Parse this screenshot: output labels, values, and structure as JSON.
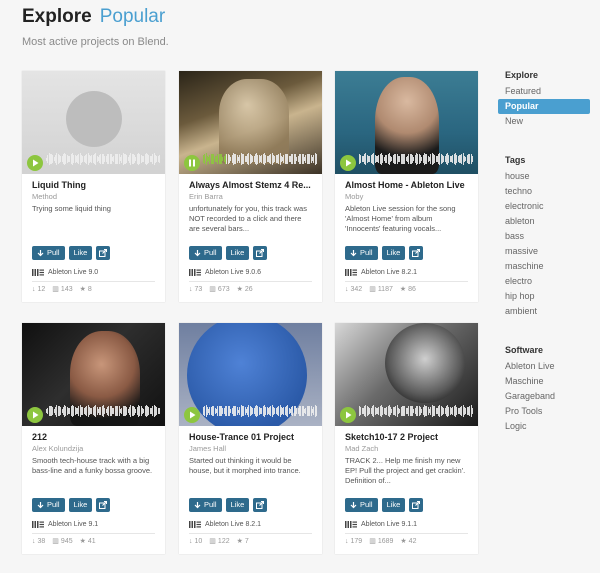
{
  "header": {
    "title": "Explore",
    "subtitle_tab": "Popular",
    "description": "Most active projects on Blend."
  },
  "cards": [
    {
      "title": "Liquid Thing",
      "author": "Method",
      "desc": "Trying some liquid thing",
      "pull": "Pull",
      "like": "Like",
      "daw": "Ableton Live 9.0",
      "downloads": "12",
      "plays": "143",
      "stars": "8",
      "playing": false
    },
    {
      "title": "Always Almost Stemz 4 Re...",
      "author": "Erin Barra",
      "desc": "unfortunately for you, this track was NOT recorded to a click and there are several bars...",
      "pull": "Pull",
      "like": "Like",
      "daw": "Ableton Live 9.0.6",
      "downloads": "73",
      "plays": "673",
      "stars": "26",
      "playing": true
    },
    {
      "title": "Almost Home - Ableton Live",
      "author": "Moby",
      "desc": "Ableton Live session for the song 'Almost Home' from album 'Innocents' featuring vocals...",
      "pull": "Pull",
      "like": "Like",
      "daw": "Ableton Live 8.2.1",
      "downloads": "342",
      "plays": "1187",
      "stars": "86",
      "playing": false
    },
    {
      "title": "212",
      "author": "Alex Kolundzija",
      "desc": "Smooth tech-house track with a big bass-line and a funky bossa groove.",
      "pull": "Pull",
      "like": "Like",
      "daw": "Ableton Live 9.1",
      "downloads": "38",
      "plays": "945",
      "stars": "41",
      "playing": false
    },
    {
      "title": "House-Trance 01 Project",
      "author": "James Hall",
      "desc": "Started out thinking it would be house, but it morphed into trance.",
      "pull": "Pull",
      "like": "Like",
      "daw": "Ableton Live 8.2.1",
      "downloads": "10",
      "plays": "122",
      "stars": "7",
      "playing": false
    },
    {
      "title": "Sketch10-17 2 Project",
      "author": "Mad Zach",
      "desc": "TRACK 2... Help me finish my new EP! Pull the project and get crackin'. Definition of...",
      "pull": "Pull",
      "like": "Like",
      "daw": "Ableton Live 9.1.1",
      "downloads": "179",
      "plays": "1689",
      "stars": "42",
      "playing": false
    }
  ],
  "sidebar": {
    "explore_heading": "Explore",
    "explore": [
      "Featured",
      "Popular",
      "New"
    ],
    "tags_heading": "Tags",
    "tags": [
      "house",
      "techno",
      "electronic",
      "ableton",
      "bass",
      "massive",
      "maschine",
      "electro",
      "hip hop",
      "ambient"
    ],
    "software_heading": "Software",
    "software": [
      "Ableton Live",
      "Maschine",
      "Garageband",
      "Pro Tools",
      "Logic"
    ]
  },
  "colors": {
    "accent": "#4a9fd0",
    "button": "#2e6a8c",
    "play": "#8dc63f"
  }
}
